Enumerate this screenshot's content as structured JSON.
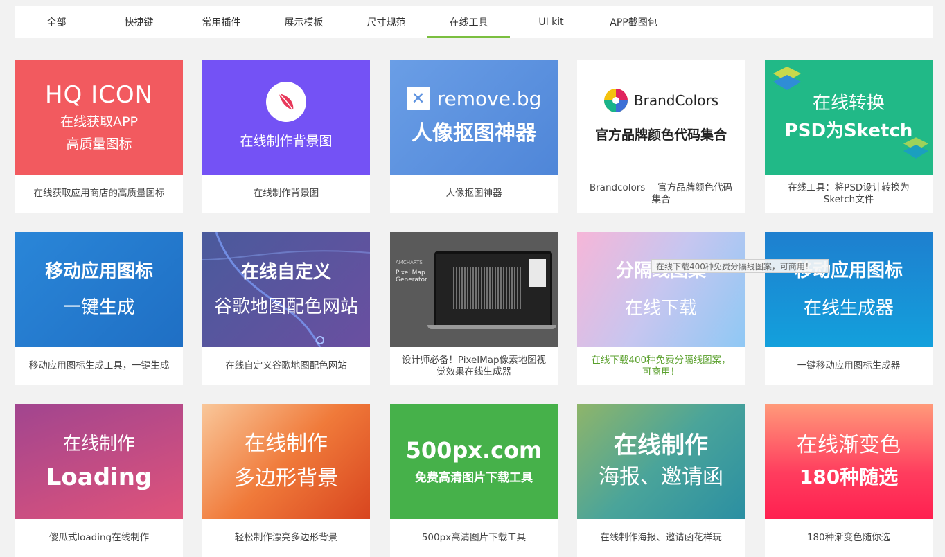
{
  "tabs": [
    "全部",
    "快捷键",
    "常用插件",
    "展示模板",
    "尺寸规范",
    "在线工具",
    "UI kit",
    "APP截图包"
  ],
  "active_tab": "在线工具",
  "cards": [
    {
      "thumb_lines": [
        "HQ ICON",
        "在线获取APP",
        "高质量图标"
      ],
      "caption": "在线获取应用商店的高质量图标"
    },
    {
      "thumb_lines": [
        "在线制作背景图"
      ],
      "caption": "在线制作背景图"
    },
    {
      "thumb_lines": [
        "remove.bg",
        "人像抠图神器"
      ],
      "caption": "人像抠图神器"
    },
    {
      "thumb_lines": [
        "BrandColors",
        "官方品牌颜色代码集合"
      ],
      "caption": "Brandcolors —官方品牌颜色代码集合"
    },
    {
      "thumb_lines": [
        "在线转换",
        "PSD为Sketch"
      ],
      "caption": "在线工具：将PSD设计转换为Sketch文件"
    },
    {
      "thumb_lines": [
        "移动应用图标",
        "一键生成"
      ],
      "caption": "移动应用图标生成工具，一键生成"
    },
    {
      "thumb_lines": [
        "在线自定义",
        "谷歌地图配色网站"
      ],
      "caption": "在线自定义谷歌地图配色网站"
    },
    {
      "thumb_lines": [
        "AMCHARTS",
        "Pixel Map Generator"
      ],
      "caption": "设计师必备！PixelMap像素地图视觉效果在线生成器"
    },
    {
      "thumb_lines": [
        "分隔线图案",
        "在线下载"
      ],
      "caption": "在线下载400种免费分隔线图案，可商用！"
    },
    {
      "thumb_lines": [
        "移动应用图标",
        "在线生成器"
      ],
      "caption": "一键移动应用图标生成器"
    },
    {
      "thumb_lines": [
        "在线制作",
        "Loading"
      ],
      "caption": "傻瓜式loading在线制作"
    },
    {
      "thumb_lines": [
        "在线制作",
        "多边形背景"
      ],
      "caption": "轻松制作漂亮多边形背景"
    },
    {
      "thumb_lines": [
        "500px.com",
        "免费高清图片下载工具"
      ],
      "caption": "500px高清图片下载工具"
    },
    {
      "thumb_lines": [
        "在线制作",
        "海报、邀请函"
      ],
      "caption": "在线制作海报、邀请函花样玩"
    },
    {
      "thumb_lines": [
        "在线渐变色",
        "180种随选"
      ],
      "caption": "180种渐变色随你选"
    }
  ],
  "tooltip": "在线下载400种免费分隔线图案，可商用！",
  "colors": {
    "accent": "#7bbf3f",
    "hover_caption": "#5aa02c"
  }
}
